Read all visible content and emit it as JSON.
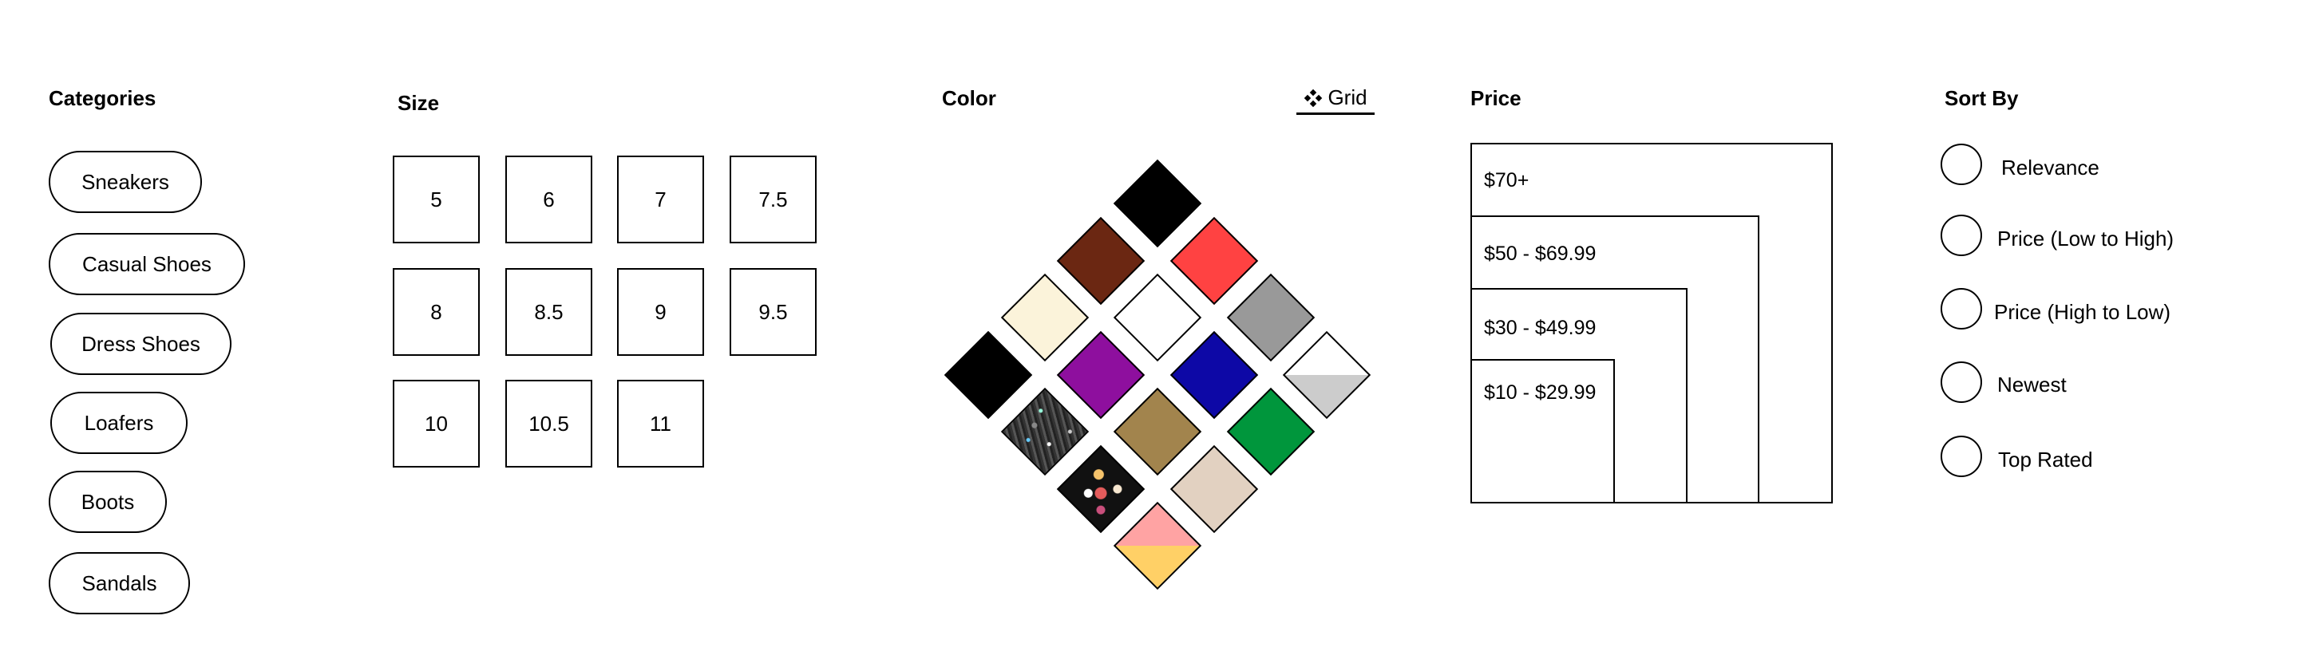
{
  "categories": {
    "heading": "Categories",
    "items": [
      "Sneakers",
      "Casual Shoes",
      "Dress Shoes",
      "Loafers",
      "Boots",
      "Sandals"
    ]
  },
  "size": {
    "heading": "Size",
    "items": [
      "5",
      "6",
      "7",
      "7.5",
      "8",
      "8.5",
      "9",
      "9.5",
      "10",
      "10.5",
      "11"
    ]
  },
  "color": {
    "heading": "Color",
    "view_toggle": {
      "label": "Grid",
      "icon": "grid-diamonds-icon"
    },
    "swatches": [
      {
        "name": "black",
        "fill": "#000000"
      },
      {
        "name": "brown",
        "fill": "#6b2712"
      },
      {
        "name": "red",
        "fill": "#ff4242"
      },
      {
        "name": "cream",
        "fill": "#fbf3da"
      },
      {
        "name": "white",
        "fill": "#ffffff"
      },
      {
        "name": "gray",
        "fill": "#999999"
      },
      {
        "name": "black",
        "fill": "#000000"
      },
      {
        "name": "purple",
        "fill": "#8e0f9e"
      },
      {
        "name": "blue",
        "fill": "#0d08a6"
      },
      {
        "name": "white-silver",
        "fill": "#ffffff",
        "fill2": "#cccccc"
      },
      {
        "name": "glitter",
        "fill": "#222222"
      },
      {
        "name": "tan",
        "fill": "#a2844d"
      },
      {
        "name": "green",
        "fill": "#00963c"
      },
      {
        "name": "floral",
        "fill": "#111111"
      },
      {
        "name": "beige",
        "fill": "#e2d1c1"
      },
      {
        "name": "pink-yellow",
        "fill": "#ffa3a3",
        "fill2": "#ffd066"
      }
    ]
  },
  "price": {
    "heading": "Price",
    "ranges": [
      "$70+",
      "$50 - $69.99",
      "$30 - $49.99",
      "$10 - $29.99"
    ]
  },
  "sort": {
    "heading": "Sort By",
    "options": [
      "Relevance",
      "Price (Low to High)",
      "Price (High to Low)",
      "Newest",
      "Top Rated"
    ]
  }
}
